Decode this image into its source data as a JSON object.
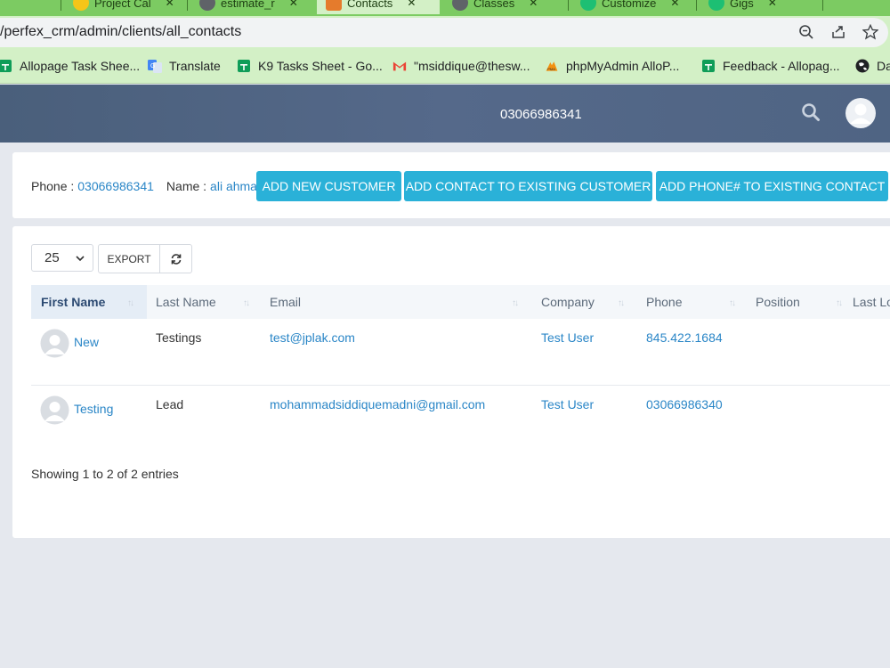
{
  "browser": {
    "tabs": [
      {
        "label": "Project Cal"
      },
      {
        "label": "estimate_r"
      },
      {
        "label": "Contacts"
      },
      {
        "label": "Classes"
      },
      {
        "label": "Customize"
      },
      {
        "label": "Gigs"
      }
    ],
    "url": "/perfex_crm/admin/clients/all_contacts",
    "bookmarks": [
      {
        "label": "Allopage Task Shee...",
        "icon": "sheets-icon"
      },
      {
        "label": "Translate",
        "icon": "translate-icon"
      },
      {
        "label": "K9 Tasks Sheet - Go...",
        "icon": "sheets-icon"
      },
      {
        "label": "\"msiddique@thesw...",
        "icon": "gmail-icon"
      },
      {
        "label": "phpMyAdmin AlloP...",
        "icon": "phpmyadmin-icon"
      },
      {
        "label": "Feedback - Allopag...",
        "icon": "sheets-icon"
      },
      {
        "label": "Da",
        "icon": "globe-icon"
      }
    ]
  },
  "header": {
    "phone": "03066986341"
  },
  "info": {
    "phone_label": "Phone :",
    "phone_value": "03066986341",
    "name_label": "Name :",
    "name_value": "ali ahmad",
    "buttons": {
      "add_customer": "ADD NEW CUSTOMER",
      "add_contact": "ADD CONTACT TO EXISTING CUSTOMER",
      "add_phone": "ADD PHONE# TO EXISTING CONTACT"
    }
  },
  "controls": {
    "page_length": "25",
    "export_label": "EXPORT"
  },
  "table": {
    "columns": [
      "First Name",
      "Last Name",
      "Email",
      "Company",
      "Phone",
      "Position",
      "Last Lo"
    ],
    "rows": [
      {
        "first_name": "New",
        "last_name": "Testings",
        "email": "test@jplak.com",
        "company": "Test User",
        "phone": "845.422.1684",
        "position": ""
      },
      {
        "first_name": "Testing",
        "last_name": "Lead",
        "email": "mohammadsiddiquemadni@gmail.com",
        "company": "Test User",
        "phone": "03066986340",
        "position": ""
      }
    ],
    "footer": "Showing 1 to 2 of 2 entries"
  },
  "colors": {
    "tab_strip": "#7ccb62",
    "header": "#55698a",
    "primary_button": "#2ab1d8",
    "link": "#2a86c7"
  }
}
